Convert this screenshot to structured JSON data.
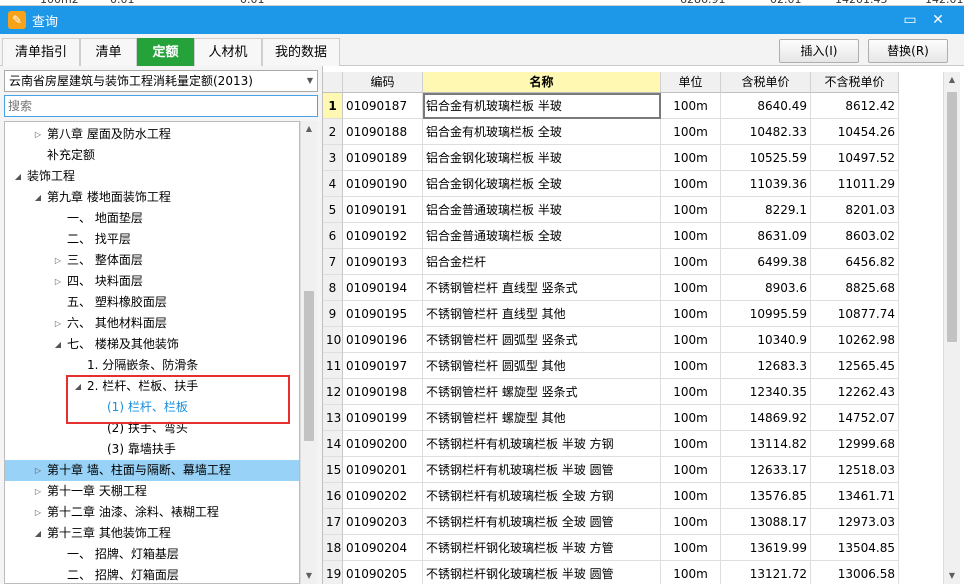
{
  "background_strip": {
    "values": [
      "100m2",
      "0.01",
      "0.01",
      "6286.91",
      "02.01",
      "14201.45",
      "142.01"
    ]
  },
  "window": {
    "title": "查询",
    "icon": "edit-icon"
  },
  "tabs": [
    {
      "label": "清单指引",
      "active": false
    },
    {
      "label": "清单",
      "active": false
    },
    {
      "label": "定额",
      "active": true
    },
    {
      "label": "人材机",
      "active": false
    },
    {
      "label": "我的数据",
      "active": false
    }
  ],
  "toolbar": {
    "insert_label": "插入(I)",
    "replace_label": "替换(R)"
  },
  "left": {
    "dropdown_value": "云南省房屋建筑与装饰工程消耗量定额(2013)",
    "search_placeholder": "搜索",
    "tree": [
      {
        "label": "第八章 屋面及防水工程",
        "indent": 1,
        "expander": "collapsed",
        "state": "normal"
      },
      {
        "label": "补充定额",
        "indent": 1,
        "expander": "none",
        "state": "normal"
      },
      {
        "label": "装饰工程",
        "indent": 0,
        "expander": "expanded",
        "state": "normal"
      },
      {
        "label": "第九章 楼地面装饰工程",
        "indent": 1,
        "expander": "expanded",
        "state": "normal"
      },
      {
        "label": "一、 地面垫层",
        "indent": 2,
        "expander": "none",
        "state": "normal"
      },
      {
        "label": "二、 找平层",
        "indent": 2,
        "expander": "none",
        "state": "normal"
      },
      {
        "label": "三、 整体面层",
        "indent": 2,
        "expander": "collapsed",
        "state": "normal"
      },
      {
        "label": "四、 块料面层",
        "indent": 2,
        "expander": "collapsed",
        "state": "normal"
      },
      {
        "label": "五、 塑料橡胶面层",
        "indent": 2,
        "expander": "none",
        "state": "normal"
      },
      {
        "label": "六、 其他材料面层",
        "indent": 2,
        "expander": "collapsed",
        "state": "normal"
      },
      {
        "label": "七、 楼梯及其他装饰",
        "indent": 2,
        "expander": "expanded",
        "state": "normal"
      },
      {
        "label": "1. 分隔嵌条、防滑条",
        "indent": 3,
        "expander": "none",
        "state": "normal"
      },
      {
        "label": "2. 栏杆、栏板、扶手",
        "indent": 3,
        "expander": "expanded",
        "state": "normal"
      },
      {
        "label": "(1) 栏杆、栏板",
        "indent": 4,
        "expander": "none",
        "state": "blue"
      },
      {
        "label": "(2) 扶手、弯头",
        "indent": 4,
        "expander": "none",
        "state": "normal"
      },
      {
        "label": "(3) 靠墙扶手",
        "indent": 4,
        "expander": "none",
        "state": "normal"
      },
      {
        "label": "第十章 墙、柱面与隔断、幕墙工程",
        "indent": 1,
        "expander": "collapsed",
        "state": "selected"
      },
      {
        "label": "第十一章 天棚工程",
        "indent": 1,
        "expander": "collapsed",
        "state": "normal"
      },
      {
        "label": "第十二章 油漆、涂料、裱糊工程",
        "indent": 1,
        "expander": "collapsed",
        "state": "normal"
      },
      {
        "label": "第十三章 其他装饰工程",
        "indent": 1,
        "expander": "expanded",
        "state": "normal"
      },
      {
        "label": "一、 招牌、灯箱基层",
        "indent": 2,
        "expander": "none",
        "state": "normal"
      },
      {
        "label": "二、 招牌、灯箱面层",
        "indent": 2,
        "expander": "none",
        "state": "normal"
      }
    ]
  },
  "grid": {
    "columns": [
      "",
      "编码",
      "名称",
      "单位",
      "含税单价",
      "不含税单价"
    ],
    "rows": [
      [
        "1",
        "01090187",
        "铝合金有机玻璃栏板 半玻",
        "100m",
        "8640.49",
        "8612.42"
      ],
      [
        "2",
        "01090188",
        "铝合金有机玻璃栏板 全玻",
        "100m",
        "10482.33",
        "10454.26"
      ],
      [
        "3",
        "01090189",
        "铝合金钢化玻璃栏板 半玻",
        "100m",
        "10525.59",
        "10497.52"
      ],
      [
        "4",
        "01090190",
        "铝合金钢化玻璃栏板 全玻",
        "100m",
        "11039.36",
        "11011.29"
      ],
      [
        "5",
        "01090191",
        "铝合金普通玻璃栏板 半玻",
        "100m",
        "8229.1",
        "8201.03"
      ],
      [
        "6",
        "01090192",
        "铝合金普通玻璃栏板 全玻",
        "100m",
        "8631.09",
        "8603.02"
      ],
      [
        "7",
        "01090193",
        "铝合金栏杆",
        "100m",
        "6499.38",
        "6456.82"
      ],
      [
        "8",
        "01090194",
        "不锈钢管栏杆 直线型 竖条式",
        "100m",
        "8903.6",
        "8825.68"
      ],
      [
        "9",
        "01090195",
        "不锈钢管栏杆 直线型 其他",
        "100m",
        "10995.59",
        "10877.74"
      ],
      [
        "10",
        "01090196",
        "不锈钢管栏杆 圆弧型 竖条式",
        "100m",
        "10340.9",
        "10262.98"
      ],
      [
        "11",
        "01090197",
        "不锈钢管栏杆 圆弧型 其他",
        "100m",
        "12683.3",
        "12565.45"
      ],
      [
        "12",
        "01090198",
        "不锈钢管栏杆 螺旋型 竖条式",
        "100m",
        "12340.35",
        "12262.43"
      ],
      [
        "13",
        "01090199",
        "不锈钢管栏杆 螺旋型 其他",
        "100m",
        "14869.92",
        "14752.07"
      ],
      [
        "14",
        "01090200",
        "不锈钢栏杆有机玻璃栏板 半玻 方钢",
        "100m",
        "13114.82",
        "12999.68"
      ],
      [
        "15",
        "01090201",
        "不锈钢栏杆有机玻璃栏板 半玻 圆管",
        "100m",
        "12633.17",
        "12518.03"
      ],
      [
        "16",
        "01090202",
        "不锈钢栏杆有机玻璃栏板 全玻 方钢",
        "100m",
        "13576.85",
        "13461.71"
      ],
      [
        "17",
        "01090203",
        "不锈钢栏杆有机玻璃栏板 全玻 圆管",
        "100m",
        "13088.17",
        "12973.03"
      ],
      [
        "18",
        "01090204",
        "不锈钢栏杆钢化玻璃栏板 半玻 方管",
        "100m",
        "13619.99",
        "13504.85"
      ],
      [
        "19",
        "01090205",
        "不锈钢栏杆钢化玻璃栏板 半玻 圆管",
        "100m",
        "13121.72",
        "13006.58"
      ]
    ]
  },
  "colors": {
    "titlebar": "#1d97e8",
    "active_tab": "#25a33a",
    "selected_row": "#99d2f7",
    "highlight_border": "#e53030",
    "header_highlight": "#fff8b3"
  }
}
